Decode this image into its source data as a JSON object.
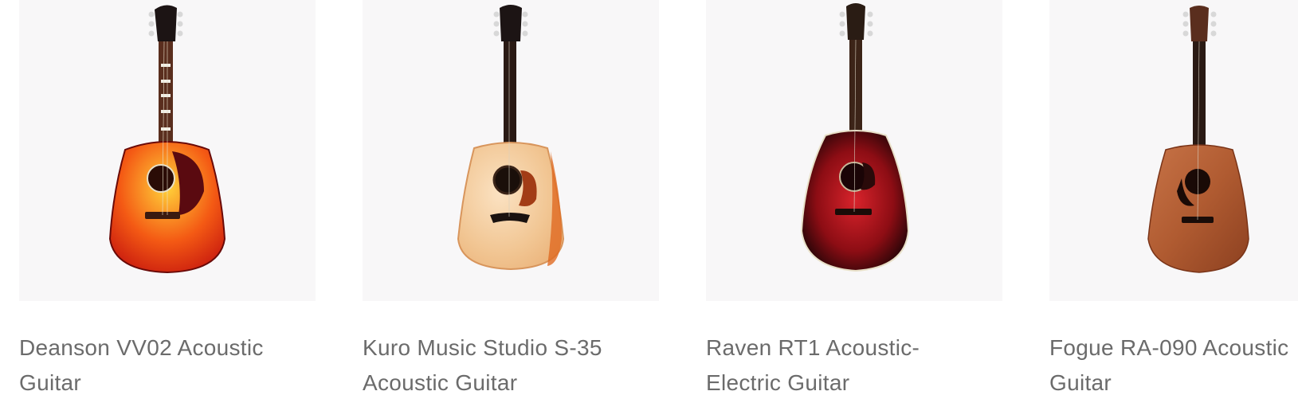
{
  "products": [
    {
      "title_line1": "Deanson VV02 Acoustic",
      "title_line2": "Guitar",
      "image_icon": "sunburst-dreadnought-guitar-image",
      "body_colors": [
        "#ffd23a",
        "#f45a14",
        "#c4140e"
      ],
      "pickguard_color": "#5a0a10"
    },
    {
      "title_line1": "Kuro Music Studio S-35",
      "title_line2": "Acoustic Guitar",
      "image_icon": "natural-dreadnought-guitar-image",
      "body_colors": [
        "#fbe2c2",
        "#f1c592",
        "#e9ae74"
      ],
      "pickguard_color": "#a23c16"
    },
    {
      "title_line1": "Raven RT1 Acoustic-",
      "title_line2": "Electric Guitar",
      "image_icon": "red-burst-slope-shoulder-guitar-image",
      "body_colors": [
        "#d8232b",
        "#8d0d14",
        "#1b0406"
      ],
      "pickguard_color": "#2a0a0a"
    },
    {
      "title_line1": "Fogue RA-090 Acoustic",
      "title_line2": "Guitar",
      "image_icon": "mahogany-dreadnought-guitar-image",
      "body_colors": [
        "#c77347",
        "#b05b31",
        "#8c4020"
      ],
      "pickguard_color": "#1a0a06"
    }
  ]
}
